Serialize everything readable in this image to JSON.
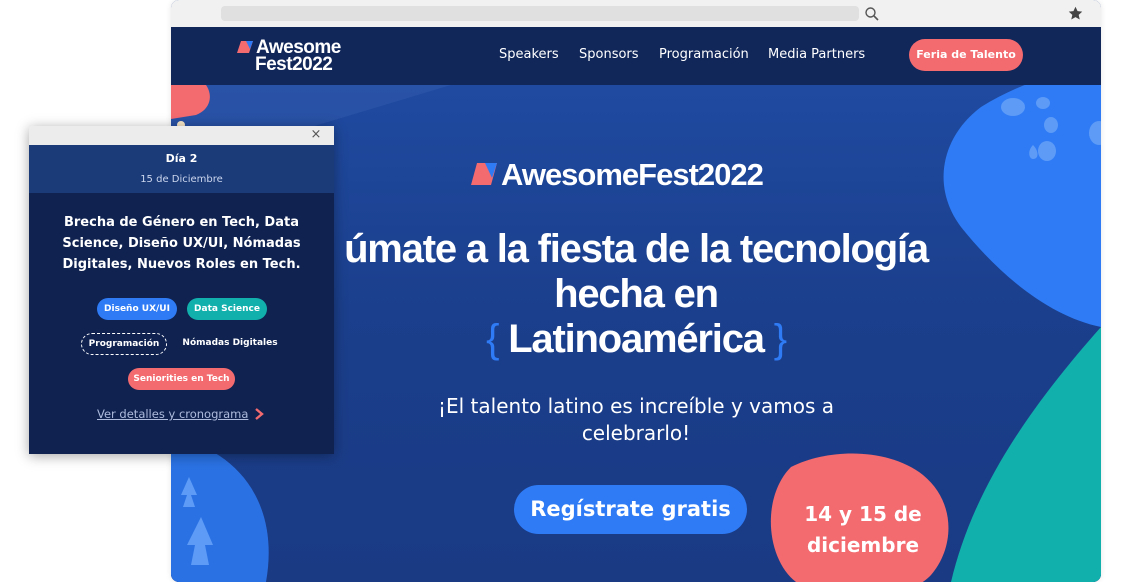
{
  "nav": {
    "logo_line1": "Awesome",
    "logo_line2": "Fest2022",
    "items": [
      "Speakers",
      "Sponsors",
      "Programación",
      "Media Partners"
    ],
    "cta": "Feria de Talento"
  },
  "hero": {
    "logo": "AwesomeFest2022",
    "headline_line1": "úmate a la fiesta de la tecnología",
    "headline_line2": "hecha en",
    "brace_open": "{",
    "headline_line3": "Latinoamérica",
    "brace_close": "}",
    "subtitle": "¡El talento latino es increíble y vamos a celebrarlo!",
    "register_button": "Regístrate gratis",
    "date_line1": "14 y 15 de",
    "date_line2": "diciembre"
  },
  "popup": {
    "close_symbol": "×",
    "day": "Día 2",
    "date": "15 de Diciembre",
    "topics": "Brecha de Género en Tech, Data Science, Diseño UX/UI, Nómadas Digitales, Nuevos Roles en Tech.",
    "chips": [
      "Diseño UX/UI",
      "Data Science",
      "Programación",
      "Nómadas Digitales",
      "Seniorities en Tech"
    ],
    "link": "Ver detalles y cronograma"
  },
  "colors": {
    "primary_blue": "#2e7bf5",
    "coral": "#f36a6f",
    "teal": "#12b0ad",
    "navy": "#11275a"
  },
  "icons": {
    "search": "search-icon",
    "star": "star-icon",
    "close": "close-icon",
    "chevron": "chevron-right-icon"
  }
}
